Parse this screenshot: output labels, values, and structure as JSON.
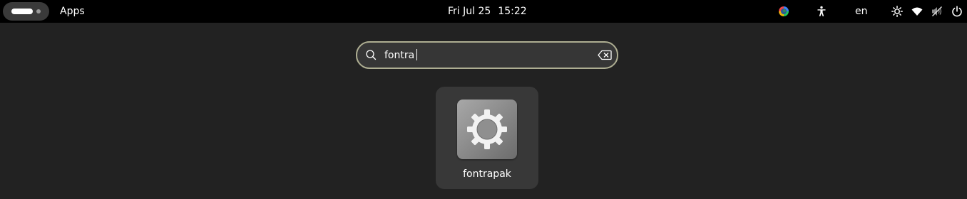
{
  "topbar": {
    "apps_label": "Apps",
    "date": "Fri Jul 25",
    "time": "15:22",
    "tray": {
      "color_picker_icon": "color-wheel-icon",
      "accessibility_icon": "accessibility-icon",
      "keyboard_layout": "en",
      "brightness_icon": "brightness-icon",
      "wifi_icon": "wifi-icon",
      "volume_icon": "volume-muted-icon",
      "power_icon": "power-icon"
    }
  },
  "search": {
    "value": "fontra",
    "search_icon": "search-icon",
    "clear_icon": "clear-text-icon"
  },
  "results": [
    {
      "label": "fontrapak",
      "icon": "gear-icon"
    }
  ],
  "colors": {
    "background": "#222222",
    "topbar": "#000000",
    "search_border": "#aeae92",
    "search_fill": "#363636",
    "tile": "#383838"
  }
}
